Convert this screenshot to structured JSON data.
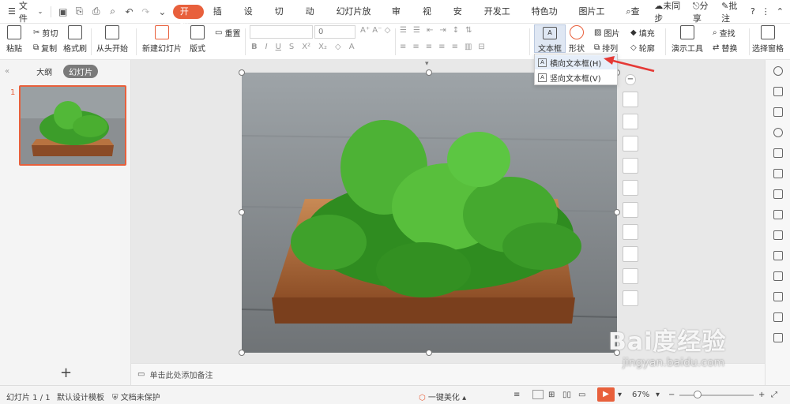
{
  "colors": {
    "accent": "#e8603c",
    "arrow": "#e53935"
  },
  "menubar": {
    "file_label": "文件",
    "tabs": [
      {
        "label": "开始",
        "active": true
      },
      {
        "label": "插入"
      },
      {
        "label": "设计"
      },
      {
        "label": "切换"
      },
      {
        "label": "动画"
      },
      {
        "label": "幻灯片放映"
      },
      {
        "label": "审阅"
      },
      {
        "label": "视图"
      },
      {
        "label": "安全"
      },
      {
        "label": "开发工具"
      },
      {
        "label": "特色功能"
      },
      {
        "label": "图片工具"
      }
    ],
    "search": "查找",
    "sync": "未同步",
    "share": "分享",
    "comment": "批注",
    "help": "?"
  },
  "ribbon": {
    "paste": "粘贴",
    "cut": "剪切",
    "copy": "复制",
    "format_painter": "格式刷",
    "from_start": "从头开始",
    "new_slide": "新建幻灯片",
    "layout": "版式",
    "reset": "重置",
    "font_size": "0",
    "textbox": "文本框",
    "shape": "形状",
    "arrange": "排列",
    "picture": "图片",
    "fill": "填充",
    "outline": "轮廓",
    "presentation_tools": "演示工具",
    "find": "查找",
    "replace": "替换",
    "select_pane": "选择窗格"
  },
  "dropdown": {
    "items": [
      "横向文本框(H)",
      "竖向文本框(V)"
    ]
  },
  "leftpane": {
    "tab_outline": "大纲",
    "tab_slides": "幻灯片",
    "slide_number": "1",
    "add": "+"
  },
  "notes": {
    "placeholder": "单击此处添加备注"
  },
  "statusbar": {
    "slide_info": "幻灯片 1 / 1",
    "template": "默认设计模板",
    "protect": "文档未保护",
    "beautify": "一键美化",
    "zoom": "67%"
  },
  "watermark": {
    "main": "Bai度经验",
    "sub": "jingyan.baidu.com"
  }
}
